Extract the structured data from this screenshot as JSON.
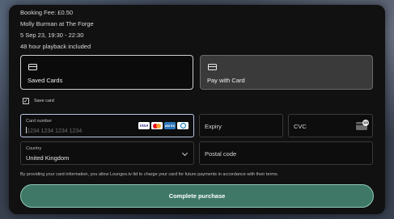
{
  "booking": {
    "fee": "Booking Fee: £0.50",
    "event": "Molly Burman at The Forge",
    "datetime": "5 Sep 23, 19:30 - 22:30",
    "playback": "48 hour playback included"
  },
  "payment_methods": {
    "saved_label": "Saved Cards",
    "card_label": "Pay with Card",
    "selected": "Pay with Card"
  },
  "save_card": {
    "label": "Save card",
    "checked": true,
    "check_glyph": "✓"
  },
  "fields": {
    "card_number_label": "Card number",
    "card_number_placeholder": "1234 1234 1234 1234",
    "expiry_label": "Expiry",
    "cvc_label": "CVC",
    "country_label": "Country",
    "country_value": "United Kingdom",
    "postal_label": "Postal code"
  },
  "card_brands": {
    "visa": "VISA",
    "amex": "AM EX"
  },
  "terms": "By providing your card information, you allow Lounges.tv ltd to charge your card for future payments in accordance with their terms.",
  "purchase_label": "Complete purchase",
  "colors": {
    "accent": "#3f7866",
    "accent_border": "#8fc9b6",
    "panel": "#111111"
  }
}
